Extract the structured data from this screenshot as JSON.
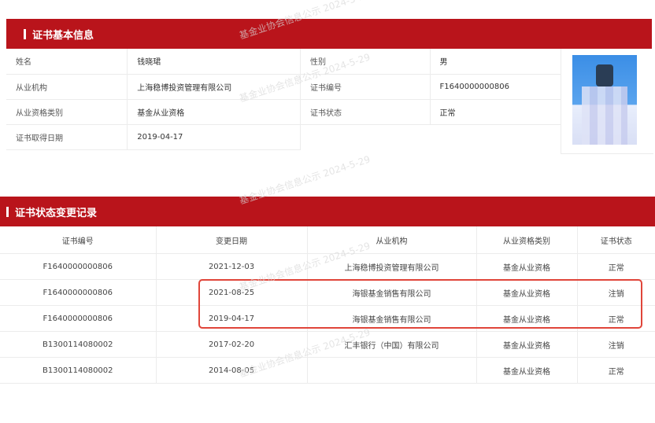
{
  "basic_info": {
    "title": "证书基本信息",
    "rows": [
      {
        "label": "姓名",
        "value": "钱晓珺",
        "label2": "性别",
        "value2": "男"
      },
      {
        "label": "从业机构",
        "value": "上海稳博投资管理有限公司",
        "label2": "证书编号",
        "value2": "F1640000000806"
      },
      {
        "label": "从业资格类别",
        "value": "基金从业资格",
        "label2": "证书状态",
        "value2": "正常"
      },
      {
        "label": "证书取得日期",
        "value": "2019-04-17"
      }
    ]
  },
  "history": {
    "title": "证书状态变更记录",
    "columns": [
      "证书编号",
      "变更日期",
      "从业机构",
      "从业资格类别",
      "证书状态"
    ],
    "rows": [
      [
        "F1640000000806",
        "2021-12-03",
        "上海稳博投资管理有限公司",
        "基金从业资格",
        "正常"
      ],
      [
        "F1640000000806",
        "2021-08-25",
        "海银基金销售有限公司",
        "基金从业资格",
        "注销"
      ],
      [
        "F1640000000806",
        "2019-04-17",
        "海银基金销售有限公司",
        "基金从业资格",
        "正常"
      ],
      [
        "B1300114080002",
        "2017-02-20",
        "汇丰银行（中国）有限公司",
        "基金从业资格",
        "注销"
      ],
      [
        "B1300114080002",
        "2014-08-05",
        "",
        "基金从业资格",
        "正常"
      ]
    ]
  },
  "watermark": "基金业协会信息公示 2024-5-29",
  "colors": {
    "accent": "#b9141b",
    "highlight": "#e0453a"
  }
}
